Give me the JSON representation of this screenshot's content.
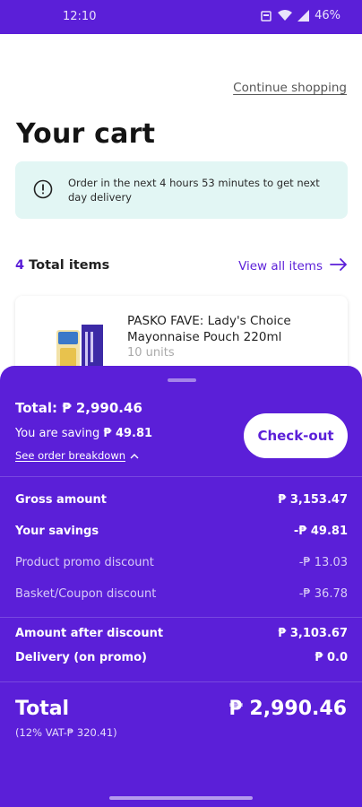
{
  "status_bar": {
    "time": "12:10",
    "battery": "46%"
  },
  "header": {
    "continue_label": "Continue shopping",
    "title": "Your cart"
  },
  "delivery_banner": {
    "text": "Order in the next 4 hours 53 minutes to get next day delivery"
  },
  "items": {
    "count": "4",
    "label": "Total items",
    "view_all": "View all items"
  },
  "product": {
    "name": "PASKO FAVE: Lady's Choice Mayonnaise Pouch 220ml",
    "quantity": "10 units"
  },
  "summary": {
    "total": "Total: ₱ 2,990.46",
    "saving_label": "You are saving",
    "saving_value": "₱ 49.81",
    "breakdown_label": "See order breakdown",
    "checkout_label": "Check-out"
  },
  "breakdown": [
    {
      "label": "Gross amount",
      "value": "₱ 3,153.47",
      "bold": true
    },
    {
      "label": "Your savings",
      "value": "-₱ 49.81",
      "bold": true
    },
    {
      "label": "Product promo discount",
      "value": "-₱ 13.03",
      "bold": false
    },
    {
      "label": "Basket/Coupon discount",
      "value": "-₱ 36.78",
      "bold": false
    }
  ],
  "after": [
    {
      "label": "Amount after discount",
      "value": "₱ 3,103.67"
    },
    {
      "label": "Delivery (on promo)",
      "value": "₱ 0.0"
    }
  ],
  "grand_total": {
    "label": "Total",
    "value": "₱ 2,990.46",
    "vat": "(12% VAT-₱ 320.41)"
  },
  "colors": {
    "brand": "#5b1fd8",
    "banner_bg": "#e2f6f4"
  }
}
